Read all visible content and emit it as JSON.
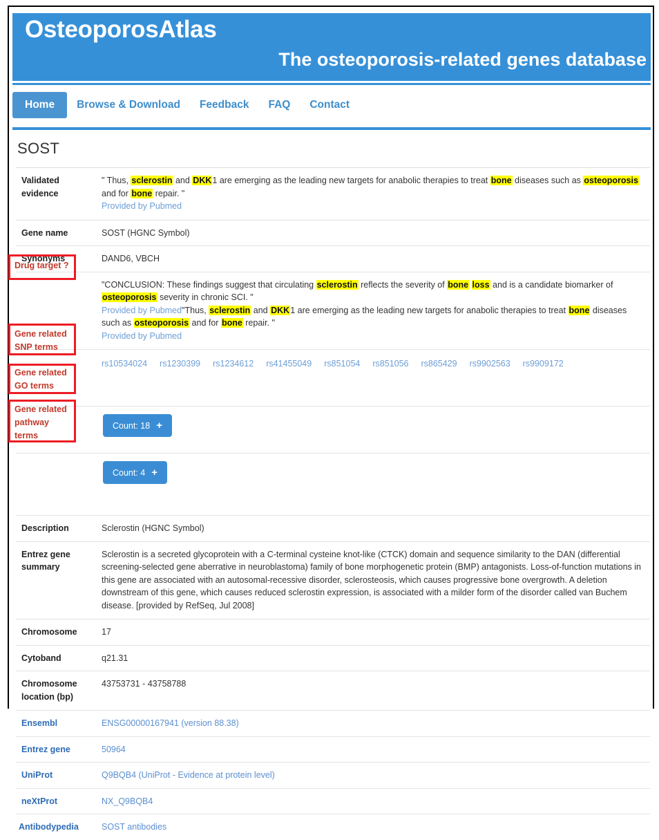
{
  "site": {
    "title": "OsteoporosAtlas",
    "tagline": "The osteoporosis-related genes database",
    "accent_color": "#3690d8",
    "highlight_color": "#ffff00",
    "annotation_color": "#ee1c25"
  },
  "nav": {
    "items": [
      {
        "label": "Home",
        "active": true
      },
      {
        "label": "Browse & Download",
        "active": false
      },
      {
        "label": "Feedback",
        "active": false
      },
      {
        "label": "FAQ",
        "active": false
      },
      {
        "label": "Contact",
        "active": false
      }
    ]
  },
  "gene": {
    "symbol": "SOST"
  },
  "labels": {
    "validated_evidence": "Validated evidence",
    "gene_name": "Gene name",
    "synonyms": "Synonyms",
    "drug_target": "Drug target ?",
    "snp_terms_l1": "Gene related",
    "snp_terms_l2": "SNP terms",
    "go_terms_l1": "Gene related",
    "go_terms_l2": "GO terms",
    "pathway_terms_l1": "Gene related",
    "pathway_terms_l2": "pathway",
    "pathway_terms_l3": "terms",
    "description": "Description",
    "entrez_summary": "Entrez gene summary",
    "chromosome": "Chromosome",
    "cytoband": "Cytoband",
    "chromosome_location": "Chromosome location (bp)",
    "ensembl": "Ensembl",
    "entrez_gene": "Entrez gene",
    "uniprot": "UniProt",
    "nextprot": "neXtProt",
    "antibodypedia": "Antibodypedia"
  },
  "validated_evidence": {
    "parts": [
      {
        "t": "\" Thus, ",
        "hl": false
      },
      {
        "t": "sclerostin",
        "hl": true
      },
      {
        "t": " and ",
        "hl": false
      },
      {
        "t": "DKK",
        "hl": true
      },
      {
        "t": "1 are emerging as the leading new targets for anabolic therapies to treat ",
        "hl": false
      },
      {
        "t": "bone",
        "hl": true
      },
      {
        "t": " diseases such as ",
        "hl": false
      },
      {
        "t": "osteoporosis",
        "hl": true
      },
      {
        "t": " and for ",
        "hl": false
      },
      {
        "t": "bone",
        "hl": true
      },
      {
        "t": " repair. \"",
        "hl": false
      }
    ],
    "source": "Provided by Pubmed"
  },
  "gene_name": "SOST (HGNC Symbol)",
  "synonyms": "DAND6, VBCH",
  "drug_target": {
    "parts1": [
      {
        "t": "\"CONCLUSION: These findings suggest that circulating ",
        "hl": false
      },
      {
        "t": "sclerostin",
        "hl": true
      },
      {
        "t": " reflects the severity of ",
        "hl": false
      },
      {
        "t": "bone",
        "hl": true
      },
      {
        "t": " ",
        "hl": false
      },
      {
        "t": "loss",
        "hl": true
      },
      {
        "t": " and is a candidate biomarker of ",
        "hl": false
      },
      {
        "t": "osteoporosis",
        "hl": true
      },
      {
        "t": " severity in chronic SCI. \"",
        "hl": false
      }
    ],
    "source1": "Provided by Pubmed",
    "parts2": [
      {
        "t": "\"Thus, ",
        "hl": false
      },
      {
        "t": "sclerostin",
        "hl": true
      },
      {
        "t": " and ",
        "hl": false
      },
      {
        "t": "DKK",
        "hl": true
      },
      {
        "t": "1 are emerging as the leading new targets for anabolic therapies to treat ",
        "hl": false
      },
      {
        "t": "bone",
        "hl": true
      },
      {
        "t": " diseases such as ",
        "hl": false
      },
      {
        "t": "osteoporosis",
        "hl": true
      },
      {
        "t": " and for ",
        "hl": false
      },
      {
        "t": "bone",
        "hl": true
      },
      {
        "t": " repair. \"",
        "hl": false
      }
    ],
    "source2": "Provided by Pubmed"
  },
  "snp_terms": [
    "rs10534024",
    "rs1230399",
    "rs1234612",
    "rs41455049",
    "rs851054",
    "rs851056",
    "rs865429",
    "rs9902563",
    "rs9909172"
  ],
  "go_terms": {
    "button_label": "Count: 18",
    "expand_icon": "+"
  },
  "pathway_terms": {
    "button_label": "Count: 4",
    "expand_icon": "+"
  },
  "description": "Sclerostin (HGNC Symbol)",
  "entrez_summary": "Sclerostin is a secreted glycoprotein with a C-terminal cysteine knot-like (CTCK) domain and sequence similarity to the DAN (differential screening-selected gene aberrative in neuroblastoma) family of bone morphogenetic protein (BMP) antagonists. Loss-of-function mutations in this gene are associated with an autosomal-recessive disorder, sclerosteosis, which causes progressive bone overgrowth. A deletion downstream of this gene, which causes reduced sclerostin expression, is associated with a milder form of the disorder called van Buchem disease. [provided by RefSeq, Jul 2008]",
  "chromosome": "17",
  "cytoband": "q21.31",
  "chromosome_location": "43753731 - 43758788",
  "ensembl_value": "ENSG00000167941 (version 88.38)",
  "entrez_gene_value": "50964",
  "uniprot_value": "Q9BQB4 (UniProt - Evidence at protein level)",
  "nextprot_value": "NX_Q9BQB4",
  "antibodypedia_value": "SOST antibodies"
}
